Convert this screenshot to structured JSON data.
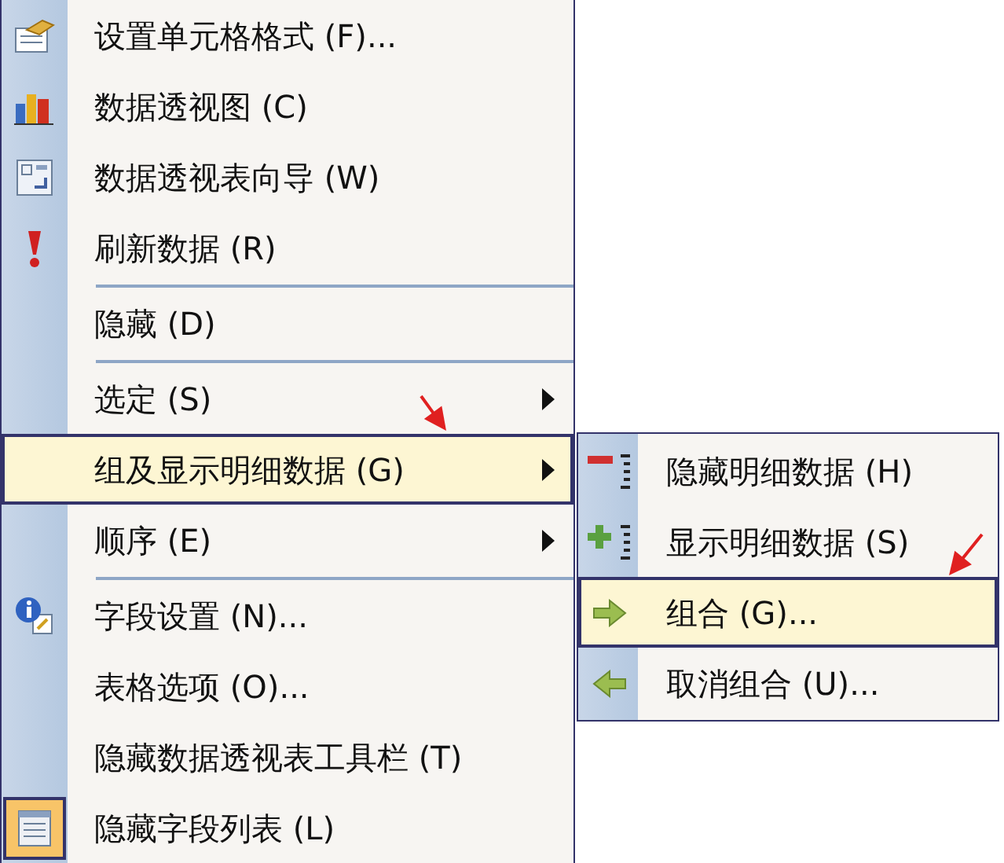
{
  "menu": {
    "items": [
      {
        "kind": "command",
        "label": "设置单元格格式 (F)...",
        "selected": false,
        "checked": false,
        "submenu": false
      },
      {
        "kind": "command",
        "label": "数据透视图 (C)",
        "selected": false,
        "checked": false,
        "submenu": false
      },
      {
        "kind": "command",
        "label": "数据透视表向导 (W)",
        "selected": false,
        "checked": false,
        "submenu": false
      },
      {
        "kind": "command",
        "label": "刷新数据 (R)",
        "selected": false,
        "checked": false,
        "submenu": false
      },
      {
        "kind": "separator"
      },
      {
        "kind": "command",
        "label": "隐藏 (D)",
        "selected": false,
        "checked": false,
        "submenu": false
      },
      {
        "kind": "separator"
      },
      {
        "kind": "command",
        "label": "选定 (S)",
        "selected": false,
        "checked": false,
        "submenu": true
      },
      {
        "kind": "command",
        "label": "组及显示明细数据 (G)",
        "selected": true,
        "checked": false,
        "submenu": true
      },
      {
        "kind": "command",
        "label": "顺序 (E)",
        "selected": false,
        "checked": false,
        "submenu": true
      },
      {
        "kind": "separator"
      },
      {
        "kind": "command",
        "label": "字段设置 (N)...",
        "selected": false,
        "checked": false,
        "submenu": false
      },
      {
        "kind": "command",
        "label": "表格选项 (O)...",
        "selected": false,
        "checked": false,
        "submenu": false
      },
      {
        "kind": "command",
        "label": "隐藏数据透视表工具栏 (T)",
        "selected": false,
        "checked": false,
        "submenu": false
      },
      {
        "kind": "command",
        "label": "隐藏字段列表 (L)",
        "selected": false,
        "checked": true,
        "submenu": false
      }
    ]
  },
  "submenu": {
    "items": [
      {
        "label": "隐藏明细数据 (H)",
        "selected": false
      },
      {
        "label": "显示明细数据 (S)",
        "selected": false
      },
      {
        "label": "组合 (G)...",
        "selected": true
      },
      {
        "label": "取消组合 (U)...",
        "selected": false
      }
    ]
  }
}
